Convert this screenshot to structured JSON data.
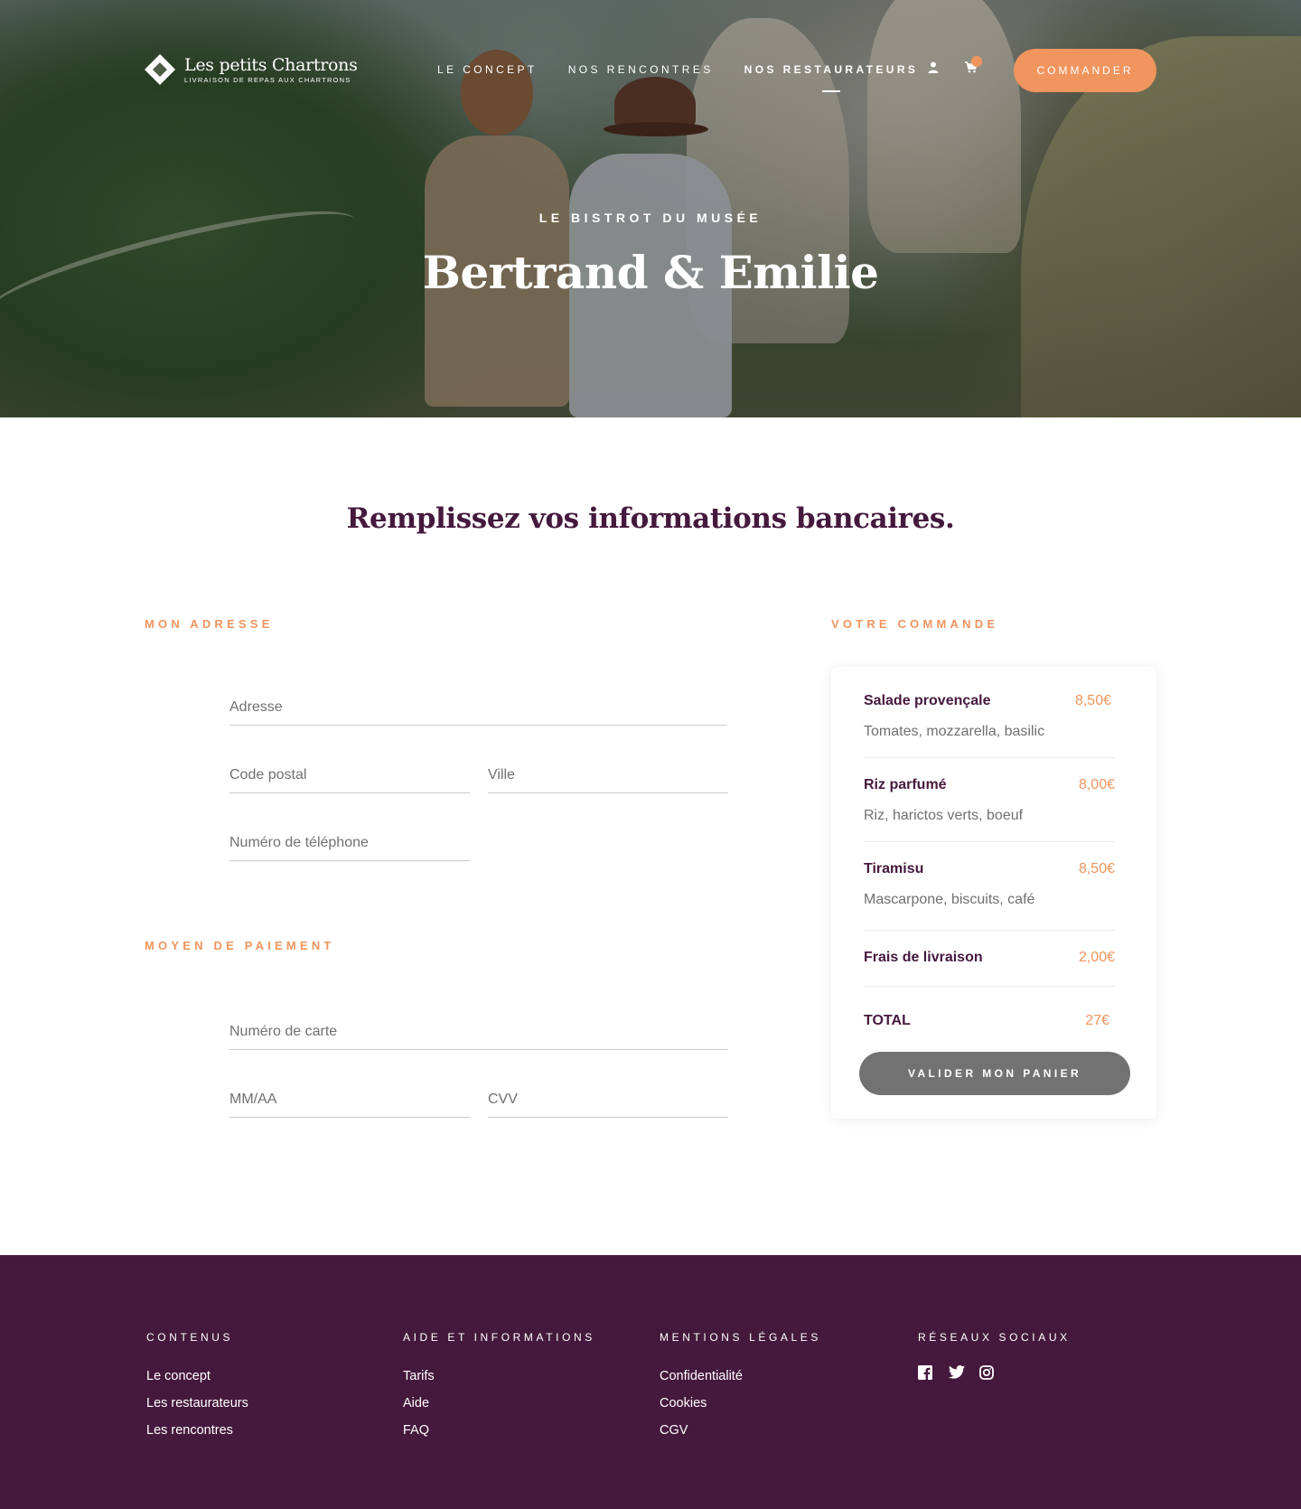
{
  "brand": {
    "name": "Les petits Chartrons",
    "tagline": "LIVRAISON DE REPAS AUX CHARTRONS"
  },
  "nav": {
    "items": [
      {
        "label": "LE CONCEPT",
        "active": false
      },
      {
        "label": "NOS RENCONTRES",
        "active": false
      },
      {
        "label": "NOS RESTAURATEURS",
        "active": true
      }
    ],
    "user_icon": "user-icon",
    "cart_icon": "cart-icon",
    "cart_count": "",
    "cta_label": "COMMANDER"
  },
  "hero": {
    "kicker": "LE BISTROT DU MUSÉE",
    "title": "Bertrand & Emilie"
  },
  "page_title": "Remplissez vos informations bancaires.",
  "address": {
    "section_label": "MON ADRESSE",
    "fields": {
      "address": {
        "placeholder": "Adresse",
        "value": ""
      },
      "postal_code": {
        "placeholder": "Code postal",
        "value": ""
      },
      "city": {
        "placeholder": "Ville",
        "value": ""
      },
      "phone": {
        "placeholder": "Numéro de téléphone",
        "value": ""
      }
    }
  },
  "payment": {
    "section_label": "MOYEN DE PAIEMENT",
    "fields": {
      "card_number": {
        "placeholder": "Numéro de carte",
        "value": ""
      },
      "expiry": {
        "placeholder": "MM/AA",
        "value": ""
      },
      "cvv": {
        "placeholder": "CVV",
        "value": ""
      }
    }
  },
  "order": {
    "section_label": "VOTRE COMMANDE",
    "items": [
      {
        "name": "Salade provençale",
        "price": "8,50€",
        "description": "Tomates, mozzarella, basilic"
      },
      {
        "name": "Riz parfumé",
        "price": "8,00€",
        "description": "Riz, harictos verts, boeuf"
      },
      {
        "name": "Tiramisu",
        "price": "8,50€",
        "description": "Mascarpone, biscuits, café"
      }
    ],
    "delivery": {
      "label": "Frais de livraison",
      "price": "2,00€"
    },
    "total": {
      "label": "TOTAL",
      "price": "27€"
    },
    "validate_label": "VALIDER MON PANIER"
  },
  "footer": {
    "columns": [
      {
        "heading": "CONTENUS",
        "links": [
          "Le concept",
          "Les restaurateurs",
          "Les rencontres"
        ]
      },
      {
        "heading": "AIDE ET INFORMATIONS",
        "links": [
          "Tarifs",
          "Aide",
          "FAQ"
        ]
      },
      {
        "heading": "MENTIONS LÉGALES",
        "links": [
          "Confidentialité",
          "Cookies",
          "CGV"
        ]
      }
    ],
    "social": {
      "heading": "RÉSEAUX SOCIAUX",
      "icons": [
        "facebook-icon",
        "twitter-icon",
        "instagram-icon"
      ]
    }
  },
  "colors": {
    "accent": "#f0955e",
    "brand_purple": "#45193d",
    "button_grey": "#727272"
  }
}
